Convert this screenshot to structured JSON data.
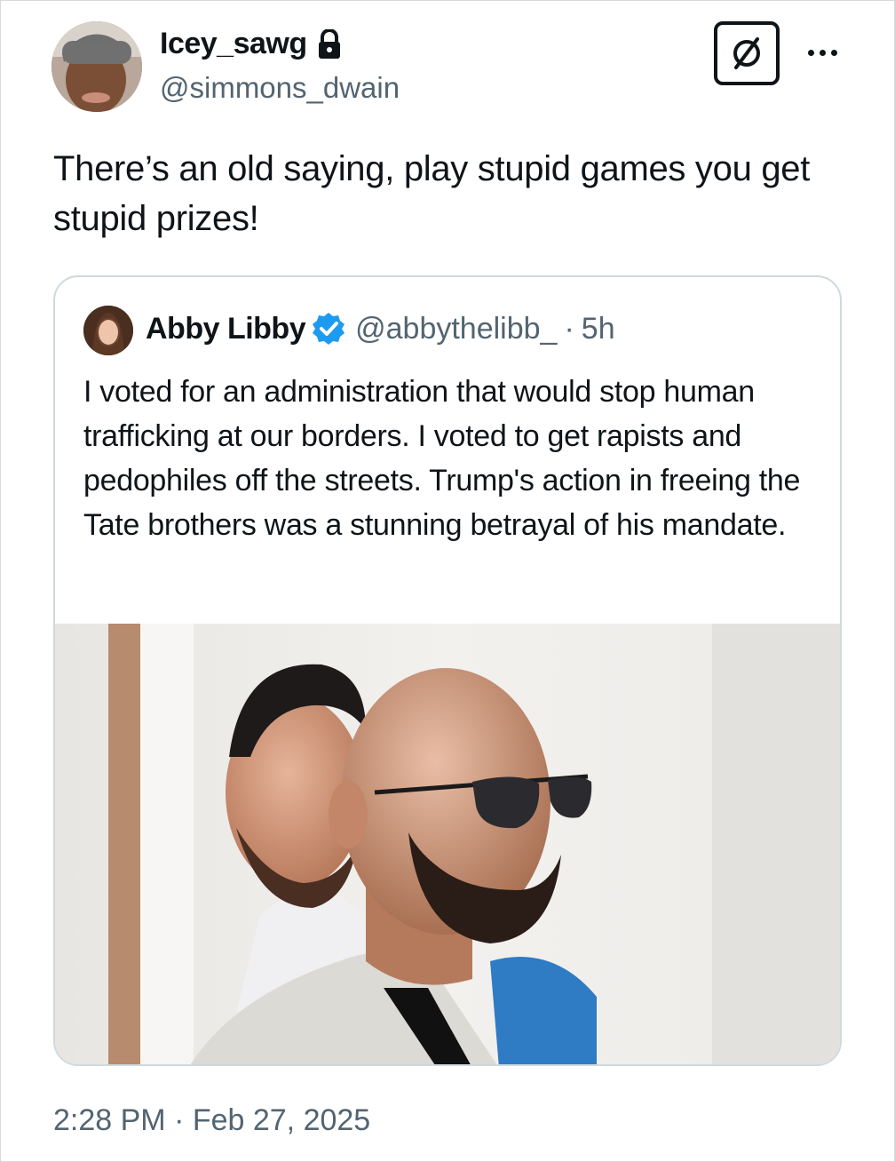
{
  "author": {
    "display_name": "Icey_sawg",
    "handle": "@simmons_dwain",
    "protected_icon": "lock-icon",
    "avatar_icon": "avatar"
  },
  "header_actions": {
    "grok_icon": "grok-icon",
    "more_icon": "more-horizontal-icon"
  },
  "tweet": {
    "text": "There’s an old saying, play stupid games you get stupid prizes!",
    "timestamp": "2:28 PM · Feb 27, 2025"
  },
  "quote": {
    "display_name": "Abby Libby",
    "verified_icon": "verified-badge-icon",
    "handle": "@abbythelibb_",
    "separator": "·",
    "time": "5h",
    "text": "I voted for an administration that would stop human trafficking at our borders. I voted to get rapists and pedophiles off the streets. Trump's action in freeing the Tate brothers was a stunning betrayal of his mandate.",
    "image": "photo"
  },
  "colors": {
    "text_primary": "#0f1419",
    "text_secondary": "#536471",
    "border": "#cfd9de",
    "verified_blue": "#1d9bf0"
  }
}
